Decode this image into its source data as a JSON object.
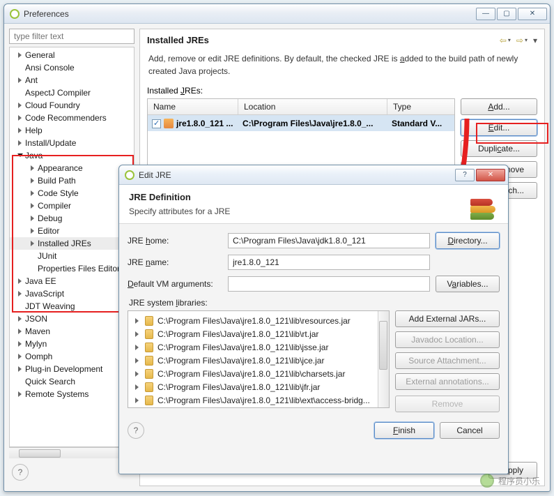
{
  "prefs": {
    "title": "Preferences",
    "filter_placeholder": "type filter text",
    "head": "Installed JREs",
    "desc_pre": "Add, remove or edit JRE definitions. By default, the checked JRE is ",
    "desc_u": "a",
    "desc_post": "dded to the build path of newly created Java projects.",
    "table_label_pre": "Installed ",
    "table_label_u": "J",
    "table_label_post": "REs:",
    "columns": {
      "name": "Name",
      "location": "Location",
      "type": "Type"
    },
    "row": {
      "name": "jre1.8.0_121 ...",
      "location": "C:\\Program Files\\Java\\jre1.8.0_...",
      "type": "Standard V..."
    },
    "buttons": {
      "add_pre": "",
      "add_u": "A",
      "add_post": "dd...",
      "edit_pre": "",
      "edit_u": "E",
      "edit_post": "dit...",
      "dup_pre": "Dupli",
      "dup_u": "c",
      "dup_post": "ate...",
      "rem": "move",
      "search": "ch...",
      "apply_pre": "",
      "apply_u": "A",
      "apply_post": "pply"
    },
    "tree": [
      {
        "label": "General",
        "level": 0,
        "state": "closed"
      },
      {
        "label": "Ansi Console",
        "level": 0,
        "state": "none"
      },
      {
        "label": "Ant",
        "level": 0,
        "state": "closed"
      },
      {
        "label": "AspectJ Compiler",
        "level": 0,
        "state": "none"
      },
      {
        "label": "Cloud Foundry",
        "level": 0,
        "state": "closed"
      },
      {
        "label": "Code Recommenders",
        "level": 0,
        "state": "closed"
      },
      {
        "label": "Help",
        "level": 0,
        "state": "closed"
      },
      {
        "label": "Install/Update",
        "level": 0,
        "state": "closed"
      },
      {
        "label": "Java",
        "level": 0,
        "state": "open"
      },
      {
        "label": "Appearance",
        "level": 1,
        "state": "closed"
      },
      {
        "label": "Build Path",
        "level": 1,
        "state": "closed"
      },
      {
        "label": "Code Style",
        "level": 1,
        "state": "closed"
      },
      {
        "label": "Compiler",
        "level": 1,
        "state": "closed"
      },
      {
        "label": "Debug",
        "level": 1,
        "state": "closed"
      },
      {
        "label": "Editor",
        "level": 1,
        "state": "closed"
      },
      {
        "label": "Installed JREs",
        "level": 1,
        "state": "closed",
        "sel": true
      },
      {
        "label": "JUnit",
        "level": 1,
        "state": "none"
      },
      {
        "label": "Properties Files Editor",
        "level": 1,
        "state": "none"
      },
      {
        "label": "Java EE",
        "level": 0,
        "state": "closed"
      },
      {
        "label": "JavaScript",
        "level": 0,
        "state": "closed"
      },
      {
        "label": "JDT Weaving",
        "level": 0,
        "state": "none"
      },
      {
        "label": "JSON",
        "level": 0,
        "state": "closed"
      },
      {
        "label": "Maven",
        "level": 0,
        "state": "closed"
      },
      {
        "label": "Mylyn",
        "level": 0,
        "state": "closed"
      },
      {
        "label": "Oomph",
        "level": 0,
        "state": "closed"
      },
      {
        "label": "Plug-in Development",
        "level": 0,
        "state": "closed"
      },
      {
        "label": "Quick Search",
        "level": 0,
        "state": "none"
      },
      {
        "label": "Remote Systems",
        "level": 0,
        "state": "closed"
      }
    ]
  },
  "dlg": {
    "title": "Edit JRE",
    "banner_head": "JRE Definition",
    "banner_sub": "Specify attributes for a JRE",
    "fields": {
      "home_lbl_pre": "JRE ",
      "home_lbl_u": "h",
      "home_lbl_post": "ome:",
      "home_val": "C:\\Program Files\\Java\\jdk1.8.0_121",
      "name_lbl_pre": "JRE ",
      "name_lbl_u": "n",
      "name_lbl_post": "ame:",
      "name_val": "jre1.8.0_121",
      "vm_lbl_pre": "",
      "vm_lbl_u": "D",
      "vm_lbl_post": "efault VM arguments:",
      "vm_val": "",
      "libs_lbl_pre": "JRE system ",
      "libs_lbl_u": "l",
      "libs_lbl_post": "ibraries:"
    },
    "buttons": {
      "dir_pre": "",
      "dir_u": "D",
      "dir_post": "irectory...",
      "vars_pre": "V",
      "vars_u": "a",
      "vars_post": "riables...",
      "addext": "Add External JARs...",
      "javadoc": "Javadoc Location...",
      "srcatt": "Source Attachment...",
      "extann": "External annotations...",
      "remove": "Remove",
      "finish_pre": "",
      "finish_u": "F",
      "finish_post": "inish",
      "cancel": "Cancel"
    },
    "libs": [
      "C:\\Program Files\\Java\\jre1.8.0_121\\lib\\resources.jar",
      "C:\\Program Files\\Java\\jre1.8.0_121\\lib\\rt.jar",
      "C:\\Program Files\\Java\\jre1.8.0_121\\lib\\jsse.jar",
      "C:\\Program Files\\Java\\jre1.8.0_121\\lib\\jce.jar",
      "C:\\Program Files\\Java\\jre1.8.0_121\\lib\\charsets.jar",
      "C:\\Program Files\\Java\\jre1.8.0_121\\lib\\jfr.jar",
      "C:\\Program Files\\Java\\jre1.8.0_121\\lib\\ext\\access-bridg..."
    ]
  },
  "watermark": "程序员小乐"
}
